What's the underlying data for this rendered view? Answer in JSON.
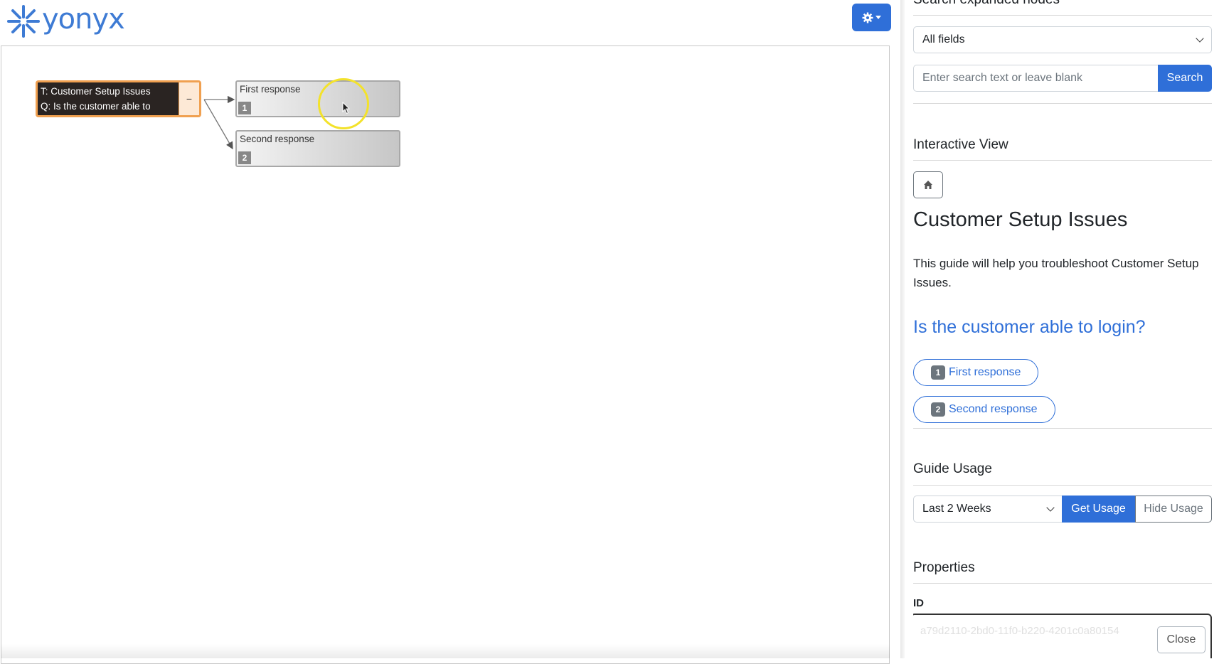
{
  "brand": {
    "logo_text": "yonyx",
    "color": "#3e7bd4"
  },
  "header": {
    "settings_icon": "gear-icon"
  },
  "tree": {
    "topic": {
      "line1": "T: Customer Setup Issues",
      "line2": "Q: Is the customer able to",
      "toggle": "−"
    },
    "responses": [
      {
        "label": "First response",
        "number": "1"
      },
      {
        "label": "Second response",
        "number": "2"
      }
    ]
  },
  "panel": {
    "search": {
      "title": "Search expanded nodes",
      "field_select": "All fields",
      "placeholder": "Enter search text or leave blank",
      "button": "Search"
    },
    "interactive": {
      "title": "Interactive View",
      "guide_title": "Customer Setup Issues",
      "description": "This guide will help you troubleshoot Customer Setup Issues.",
      "question": "Is the customer able to login?",
      "responses": [
        {
          "number": "1",
          "label": "First response"
        },
        {
          "number": "2",
          "label": "Second response"
        }
      ]
    },
    "usage": {
      "title": "Guide Usage",
      "period": "Last 2 Weeks",
      "get_button": "Get Usage",
      "hide_button": "Hide Usage"
    },
    "properties": {
      "title": "Properties",
      "id_label": "ID",
      "id_value": "a79d2110-2bd0-11f0-b220-4201c0a80154",
      "close_button": "Close"
    }
  },
  "colors": {
    "accent": "#2f6fd8",
    "topic_border": "#f0a050",
    "cursor_highlight": "#f3e22b"
  }
}
